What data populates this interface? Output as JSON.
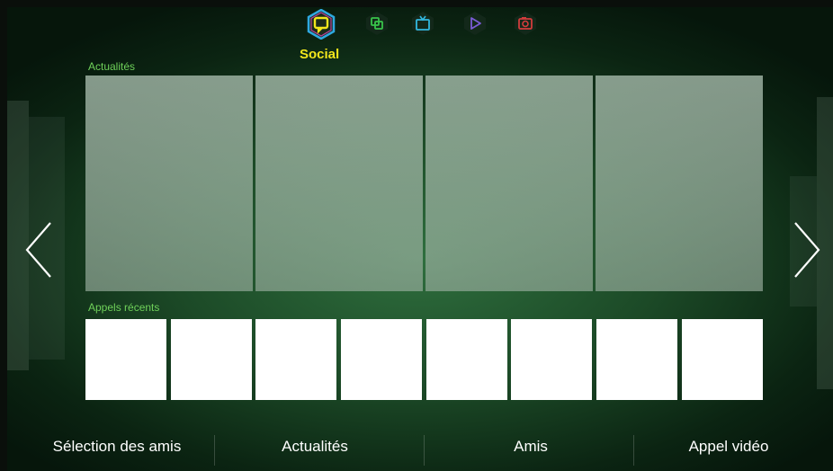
{
  "nav": {
    "active_label": "Social",
    "items": [
      {
        "icon": "social-icon",
        "color": "#f2e61c"
      },
      {
        "icon": "apps-icon",
        "color": "#39c34a"
      },
      {
        "icon": "tv-icon",
        "color": "#32b8e0"
      },
      {
        "icon": "play-icon",
        "color": "#7a5cd6"
      },
      {
        "icon": "camera-icon",
        "color": "#d23c3c"
      }
    ]
  },
  "sections": {
    "news_label": "Actualités",
    "recent_calls_label": "Appels récents"
  },
  "bottom": {
    "items": [
      "Sélection des amis",
      "Actualités",
      "Amis",
      "Appel vidéo"
    ]
  }
}
